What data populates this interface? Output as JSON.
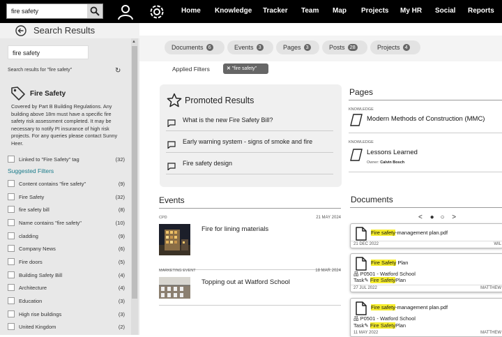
{
  "topbar": {
    "search_value": "fire safety",
    "nav": [
      "Home",
      "Knowledge",
      "Tracker",
      "Team",
      "Map",
      "Projects",
      "My HR",
      "Social",
      "Reports"
    ]
  },
  "sidebar": {
    "title": "Search Results",
    "search_value": "fire safety",
    "results_text": "Search results for \"fire safety\"",
    "tag": {
      "title": "Fire Safety",
      "description": "Covered by Part B Building Regulations. Any building above 18m must have a specific fire safety risk assessment completed. It may be necessary to notify PI insurance of high risk projects. For any queries please contact Sunny Heer."
    },
    "linked": {
      "label": "Linked to \"Fire Safety\" tag",
      "count": "(32)"
    },
    "suggested_label": "Suggested Filters",
    "filters": [
      {
        "label": "Content contains \"fire safety\"",
        "count": "(9)"
      },
      {
        "label": "Fire Safety",
        "count": "(32)"
      },
      {
        "label": "fire safety bill",
        "count": "(8)"
      },
      {
        "label": "Name contains \"fire safety\"",
        "count": "(10)"
      },
      {
        "label": "cladding",
        "count": "(9)"
      },
      {
        "label": "Company News",
        "count": "(6)"
      },
      {
        "label": "Fire doors",
        "count": "(5)"
      },
      {
        "label": "Building Safety Bill",
        "count": "(4)"
      },
      {
        "label": "Architecture",
        "count": "(4)"
      },
      {
        "label": "Education",
        "count": "(3)"
      },
      {
        "label": "High rise buildings",
        "count": "(3)"
      },
      {
        "label": "United Kingdom",
        "count": "(2)"
      }
    ]
  },
  "tabs": [
    {
      "label": "Documents",
      "count": "6"
    },
    {
      "label": "Events",
      "count": "3"
    },
    {
      "label": "Pages",
      "count": "3"
    },
    {
      "label": "Posts",
      "count": "28"
    },
    {
      "label": "Projects",
      "count": "4"
    }
  ],
  "applied_filters": {
    "label": "Applied Filters",
    "chip": "\"fire safety\""
  },
  "promoted": {
    "title": "Promoted Results",
    "items": [
      "What is the new Fire Safety Bill?",
      "Early warning system - signs of smoke and fire",
      "Fire safety design"
    ]
  },
  "pages": {
    "title": "Pages",
    "items": [
      {
        "category": "KNOWLEDGE",
        "title": "Modern Methods of Construction (MMC)",
        "owner_label": "",
        "owner": ""
      },
      {
        "category": "KNOWLEDGE",
        "title": "Lessons Learned",
        "owner_label": "Owner:",
        "owner": "Calvin Bosch"
      }
    ]
  },
  "events": {
    "title": "Events",
    "items": [
      {
        "category": "CPD",
        "date": "21 MAY 2024",
        "title": "Fire for lining materials"
      },
      {
        "category": "MARKETING EVENT",
        "date": "18 MAR 2024",
        "title": "Topping out at Watford School"
      }
    ]
  },
  "documents": {
    "title": "Documents",
    "items": [
      {
        "highlight": "Fire safety",
        "rest": "-management plan.pdf",
        "project": "",
        "task_prefix": "",
        "task_hl": "",
        "task_rest": "",
        "date": "21 DEC 2022",
        "owner": "WIL"
      },
      {
        "highlight": "Fire Safety",
        "rest": " Plan",
        "project": "P0501 - Watford School",
        "task_prefix": "Task",
        "task_hl": "Fire Safety",
        "task_rest": "Plan",
        "date": "27 JUL 2022",
        "owner": "MATTHEW"
      },
      {
        "highlight": "Fire safety",
        "rest": "-management plan.pdf",
        "project": "P0501 - Watford School",
        "task_prefix": "Task",
        "task_hl": "Fire Safety",
        "task_rest": "Plan",
        "date": "11 MAY 2022",
        "owner": "MATTHEW"
      }
    ]
  }
}
